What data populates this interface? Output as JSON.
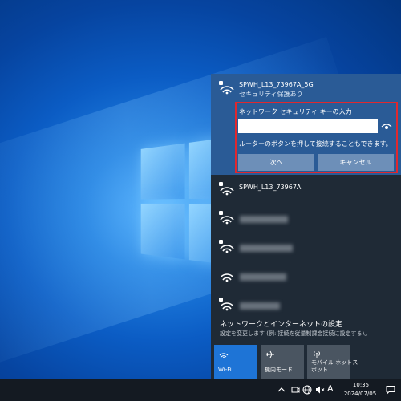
{
  "network_flyout": {
    "connecting": {
      "ssid": "SPWH_L13_73967A_5G",
      "status": "セキュリティ保護あり",
      "key_label": "ネットワーク セキュリティ キーの入力",
      "key_value": "",
      "hint": "ルーターのボタンを押して接続することもできます。",
      "next_label": "次へ",
      "cancel_label": "キャンセル"
    },
    "networks": [
      {
        "ssid": "SPWH_L13_73967A"
      },
      {
        "ssid": ""
      },
      {
        "ssid": ""
      },
      {
        "ssid": ""
      },
      {
        "ssid": ""
      }
    ],
    "settings_title": "ネットワークとインターネットの設定",
    "settings_subtitle": "設定を変更します (例: 接続を従量制課金接続に設定する)。",
    "quick_actions": [
      {
        "label": "Wi-Fi",
        "icon": "wifi-icon",
        "active": true
      },
      {
        "label": "機内モード",
        "icon": "airplane-icon",
        "active": false
      },
      {
        "label": "モバイル ホットスポット",
        "label_line1": "モバイル ホットス",
        "label_line2": "ポット",
        "icon": "hotspot-icon",
        "active": false
      }
    ]
  },
  "taskbar": {
    "ime_label": "A",
    "time": "10:35",
    "date": "2024/07/05",
    "tray_icons": [
      "chevron-up-icon",
      "onedrive-icon",
      "network-globe-icon",
      "speaker-muted-icon"
    ]
  },
  "colors": {
    "accent": "#1e74d6",
    "highlight_border": "#e0282e",
    "flyout_bg": "#1f2a36",
    "connect_bg": "#2a5b96"
  }
}
